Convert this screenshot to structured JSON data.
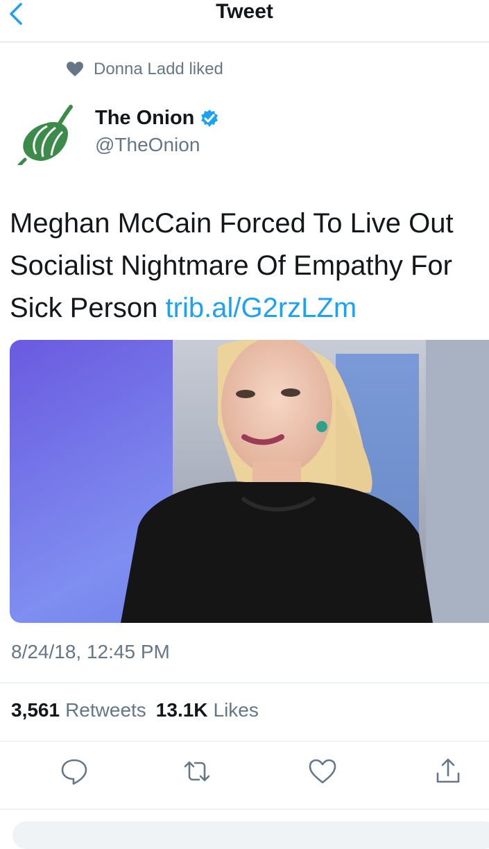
{
  "header": {
    "title": "Tweet"
  },
  "social_context": {
    "text": "Donna Ladd liked"
  },
  "author": {
    "name": "The Onion",
    "handle": "@TheOnion",
    "verified": true,
    "avatar_icon": "onion-logo-icon"
  },
  "tweet": {
    "text": "Meghan McCain Forced To Live Out Socialist Nightmare Of Empathy For Sick Person",
    "link": "trib.al/G2rzLZm",
    "timestamp": "8/24/18, 12:45 PM"
  },
  "stats": {
    "retweets_count": "3,561",
    "retweets_label": "Retweets",
    "likes_count": "13.1K",
    "likes_label": "Likes"
  },
  "actions": [
    "reply-icon",
    "retweet-icon",
    "like-icon",
    "share-icon"
  ],
  "colors": {
    "accent": "#1da1f2",
    "secondary_text": "#657786",
    "onion_green": "#3c8b4a"
  }
}
